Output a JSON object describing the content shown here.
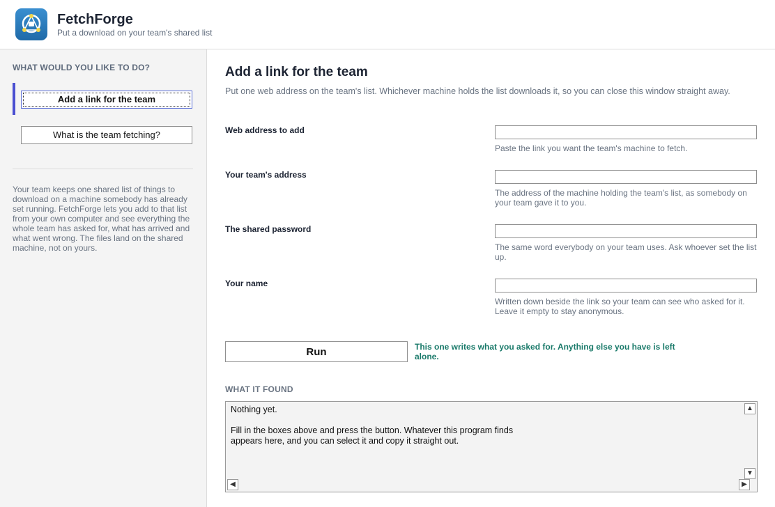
{
  "app": {
    "title": "FetchForge",
    "subtitle": "Put a download on your team's shared list"
  },
  "sidebar": {
    "heading": "WHAT WOULD YOU LIKE TO DO?",
    "items": [
      {
        "label": "Add a link for the team",
        "active": true
      },
      {
        "label": "What is the team fetching?",
        "active": false
      }
    ],
    "about": "Your team keeps one shared list of things to download on a machine somebody has already set running. FetchForge lets you add to that list from your own computer and see everything the whole team has asked for, what has arrived and what went wrong. The files land on the shared machine, not on yours."
  },
  "main": {
    "title": "Add a link for the team",
    "intro": "Put one web address on the team's list. Whichever machine holds the list downloads it, so you can close this window straight away.",
    "fields": [
      {
        "label": "Web address to add",
        "value": "",
        "help": "Paste the link you want the team's machine to fetch."
      },
      {
        "label": "Your team's address",
        "value": "",
        "help": "The address of the machine holding the team's list, as somebody on your team gave it to you."
      },
      {
        "label": "The shared password",
        "value": "",
        "help": "The same word everybody on your team uses. Ask whoever set the list up."
      },
      {
        "label": "Your name",
        "value": "",
        "help": "Written down beside the link so your team can see who asked for it. Leave it empty to stay anonymous."
      }
    ],
    "run_label": "Run",
    "run_note": "This one writes what you asked for. Anything else you have is left alone.",
    "results_heading": "WHAT IT FOUND",
    "results_text": "Nothing yet.\n\nFill in the boxes above and press the button. Whatever this program finds\nappears here, and you can select it and copy it straight out."
  },
  "colors": {
    "accent": "#4a4fd1",
    "note": "#1a7a6a",
    "logo": "#2a7bbf"
  }
}
